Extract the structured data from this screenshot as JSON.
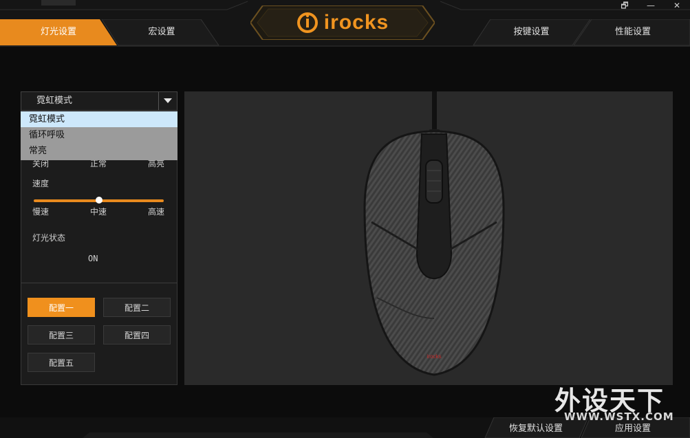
{
  "window": {
    "controls": [
      "🗗",
      "—",
      "✕"
    ]
  },
  "logo": {
    "text": "irocks"
  },
  "tabs": [
    {
      "label": "灯光设置",
      "active": true
    },
    {
      "label": "宏设置",
      "active": false
    },
    {
      "label": "按键设置",
      "active": false
    },
    {
      "label": "性能设置",
      "active": false
    }
  ],
  "lighting": {
    "mode_select": {
      "value": "霓虹模式",
      "options": [
        "霓虹模式",
        "循环呼吸",
        "常亮"
      ],
      "highlighted_index": 0
    },
    "brightness_labels": [
      "关闭",
      "正常",
      "高亮"
    ],
    "speed": {
      "title": "速度",
      "labels": [
        "慢速",
        "中速",
        "高速"
      ],
      "value_fraction": 0.5
    },
    "light_state": {
      "title": "灯光状态",
      "value": "ON"
    }
  },
  "profiles": [
    "配置一",
    "配置二",
    "配置三",
    "配置四",
    "配置五"
  ],
  "active_profile_index": 0,
  "mouse_brand_text": "irocks",
  "footer": {
    "reset_label": "恢复默认设置",
    "apply_label": "应用设置"
  },
  "watermark": {
    "cn": "外设天下",
    "en": "WWW.WSTX.COM"
  },
  "colors": {
    "accent": "#e88a1e",
    "dropdown_bg": "#9b9b9b",
    "dropdown_selected": "#cde8fb"
  }
}
